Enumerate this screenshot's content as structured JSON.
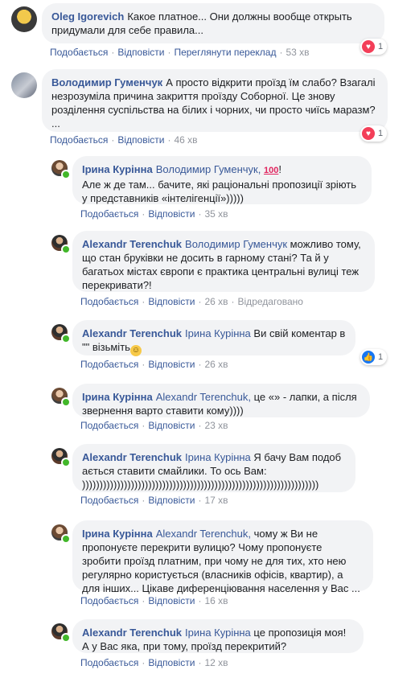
{
  "colors": {
    "link": "#385898",
    "bubble": "#f2f3f5",
    "meta": "#90949c",
    "heart": "#f33e58",
    "like": "#1877f2"
  },
  "comments": [
    {
      "author": "Oleg Igorevich",
      "mention": "",
      "text": "Какое платное... Они должны вообще открыть придумали для себе правила...",
      "actions": [
        "Подобається",
        "Відповісти",
        "Переглянути переклад"
      ],
      "time": "53 хв",
      "reactions": "1",
      "edited": ""
    },
    {
      "author": "Володимир Гуменчук",
      "mention": "",
      "text": "А просто відкрити проїзд їм слабо? Взагалі незрозуміла причина закриття проїзду Соборної. Це знову розділення суспільства на білих і чорних, чи просто чиїсь маразм? ...",
      "actions": [
        "Подобається",
        "Відповісти"
      ],
      "time": "46 хв",
      "reactions": "1",
      "edited": ""
    },
    {
      "author": "Ірина Курінна",
      "mention": "Володимир Гуменчук,",
      "text": "Але ж де там... бачите, які раціональні пропозиції зріють у представників «інтелігенції»)))))",
      "actions": [
        "Подобається",
        "Відповісти"
      ],
      "time": "35 хв",
      "reactions": "",
      "edited": ""
    },
    {
      "author": "Alexandr Terenchuk",
      "mention": "Володимир Гуменчук",
      "text": "можливо тому, що стан бруківки не досить в гарному стані? Та й у багатьох містах європи є практика центральні вулиці теж перекривати?!",
      "actions": [
        "Подобається",
        "Відповісти"
      ],
      "time": "26 хв",
      "reactions": "",
      "edited": "Відредаговано"
    },
    {
      "author": "Alexandr Terenchuk",
      "mention": "Ірина Курінна",
      "text": "Ви свій коментар в \"\" візьміть",
      "actions": [
        "Подобається",
        "Відповісти"
      ],
      "time": "26 хв",
      "reactions": "1",
      "edited": ""
    },
    {
      "author": "Ірина Курінна",
      "mention": "Alexandr Terenchuk,",
      "text": "це «» - лапки, а після звернення варто ставити кому))))",
      "actions": [
        "Подобається",
        "Відповісти"
      ],
      "time": "23 хв",
      "reactions": "",
      "edited": ""
    },
    {
      "author": "Alexandr Terenchuk",
      "mention": "Ірина Курінна",
      "text": "Я бачу Вам подобається ставити смайлики. То ось Вам: ))))))))))))))))))))))))))))))))))))))))))))))))))))))))))))))))))))",
      "actions": [
        "Подобається",
        "Відповісти"
      ],
      "time": "17 хв",
      "reactions": "",
      "edited": ""
    },
    {
      "author": "Ірина Курінна",
      "mention": "Alexandr Terenchuk,",
      "text": "чому ж Ви не пропонуєте перекрити вулицю? Чому пропонуєте зробити проїзд платним, при чому не для тих, хто нею регулярно користується (власників офісів, квартир), а для інших... Цікаве диференціювання населення у Вас ...",
      "actions": [
        "Подобається",
        "Відповісти"
      ],
      "time": "16 хв",
      "reactions": "",
      "edited": ""
    },
    {
      "author": "Alexandr Terenchuk",
      "mention": "Ірина Курінна",
      "text": "це пропозиція моя! А у Вас яка, при тому, проїзд перекритий?",
      "actions": [
        "Подобається",
        "Відповісти"
      ],
      "time": "12 хв",
      "reactions": "",
      "edited": ""
    }
  ]
}
